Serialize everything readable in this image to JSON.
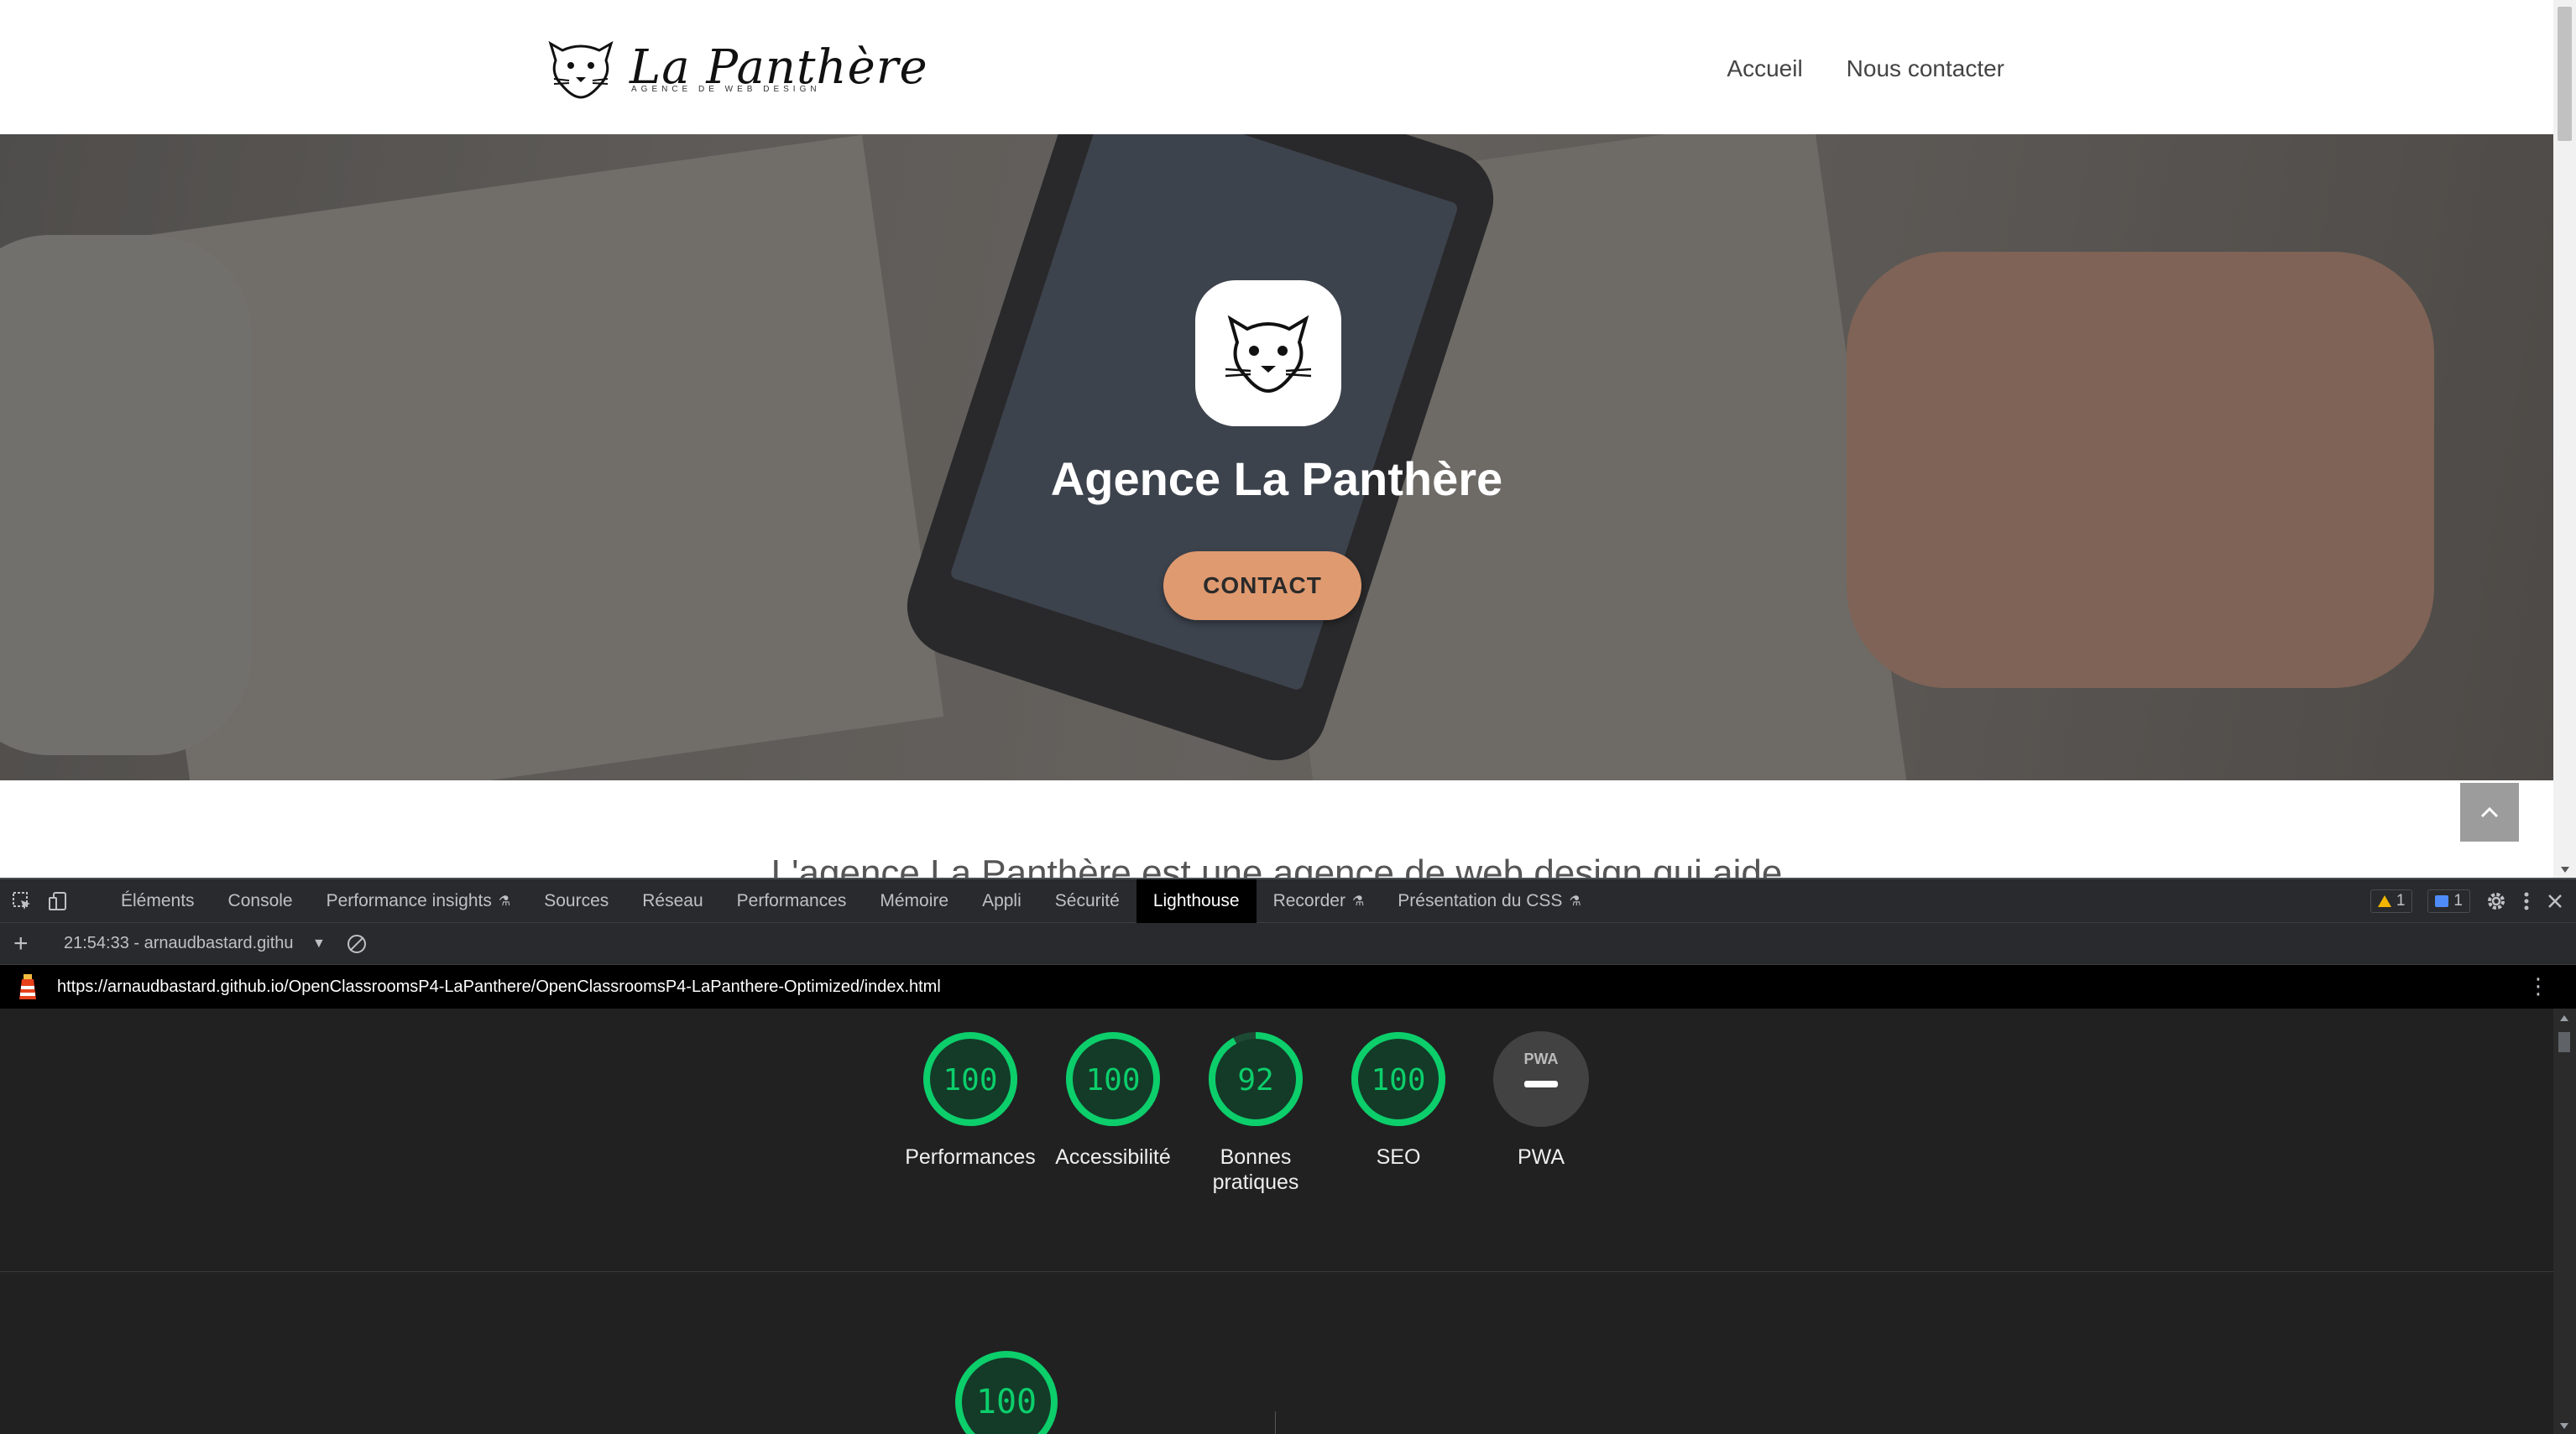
{
  "site": {
    "logo_title": "La Panthère",
    "logo_subtitle": "AGENCE DE WEB DESIGN",
    "nav": [
      {
        "label": "Accueil"
      },
      {
        "label": "Nous contacter"
      }
    ],
    "hero_title": "Agence La Panthère",
    "hero_button": "CONTACT",
    "intro_text": "L'agence La Panthère est une agence de web design qui aide",
    "accent_color": "#e09a70"
  },
  "devtools": {
    "tabs": [
      {
        "label": "Éléments",
        "flask": false
      },
      {
        "label": "Console",
        "flask": false
      },
      {
        "label": "Performance insights",
        "flask": true
      },
      {
        "label": "Sources",
        "flask": false
      },
      {
        "label": "Réseau",
        "flask": false
      },
      {
        "label": "Performances",
        "flask": false
      },
      {
        "label": "Mémoire",
        "flask": false
      },
      {
        "label": "Appli",
        "flask": false
      },
      {
        "label": "Sécurité",
        "flask": false
      },
      {
        "label": "Lighthouse",
        "flask": false,
        "active": true
      },
      {
        "label": "Recorder",
        "flask": true
      },
      {
        "label": "Présentation du CSS",
        "flask": true
      }
    ],
    "warnings_count": "1",
    "messages_count": "1",
    "report_selector": "21:54:33 - arnaudbastard.githu",
    "report_url": "https://arnaudbastard.github.io/OpenClassroomsP4-LaPanthere/OpenClassroomsP4-LaPanthere-Optimized/index.html",
    "scores": [
      {
        "label": "Performances",
        "score": "100",
        "value": 1.0
      },
      {
        "label": "Accessibilité",
        "score": "100",
        "value": 1.0
      },
      {
        "label": "Bonnes pratiques",
        "score": "92",
        "value": 0.92
      },
      {
        "label": "SEO",
        "score": "100",
        "value": 1.0
      },
      {
        "label": "PWA",
        "score": "PWA",
        "value": null
      }
    ],
    "main_score": "100",
    "pass_color": "#0cce6b"
  }
}
